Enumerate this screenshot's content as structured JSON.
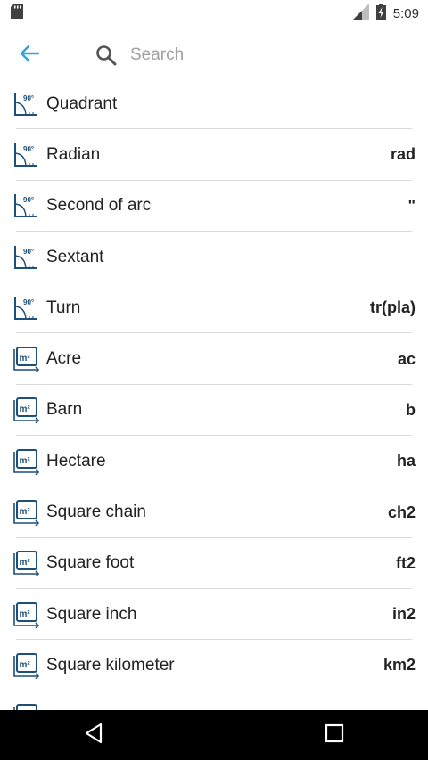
{
  "status_bar": {
    "time": "5:09"
  },
  "search": {
    "placeholder": "Search"
  },
  "units": [
    {
      "label": "Quadrant",
      "symbol": "",
      "icon": "angle-icon"
    },
    {
      "label": "Radian",
      "symbol": "rad",
      "icon": "angle-icon"
    },
    {
      "label": "Second of arc",
      "symbol": "\"",
      "icon": "angle-icon"
    },
    {
      "label": "Sextant",
      "symbol": "",
      "icon": "angle-icon"
    },
    {
      "label": "Turn",
      "symbol": "tr(pla)",
      "icon": "angle-icon"
    },
    {
      "label": "Acre",
      "symbol": "ac",
      "icon": "area-icon"
    },
    {
      "label": "Barn",
      "symbol": "b",
      "icon": "area-icon"
    },
    {
      "label": "Hectare",
      "symbol": "ha",
      "icon": "area-icon"
    },
    {
      "label": "Square chain",
      "symbol": "ch2",
      "icon": "area-icon"
    },
    {
      "label": "Square foot",
      "symbol": "ft2",
      "icon": "area-icon"
    },
    {
      "label": "Square inch",
      "symbol": "in2",
      "icon": "area-icon"
    },
    {
      "label": "Square kilometer",
      "symbol": "km2",
      "icon": "area-icon"
    },
    {
      "label": "",
      "symbol": "",
      "icon": "area-icon"
    }
  ],
  "icon_text": {
    "angle": "90°",
    "area": "m²"
  },
  "colors": {
    "accent": "#2aa6e0",
    "icon_blue": "#1c4f7a",
    "divider": "#d9d9d9"
  }
}
